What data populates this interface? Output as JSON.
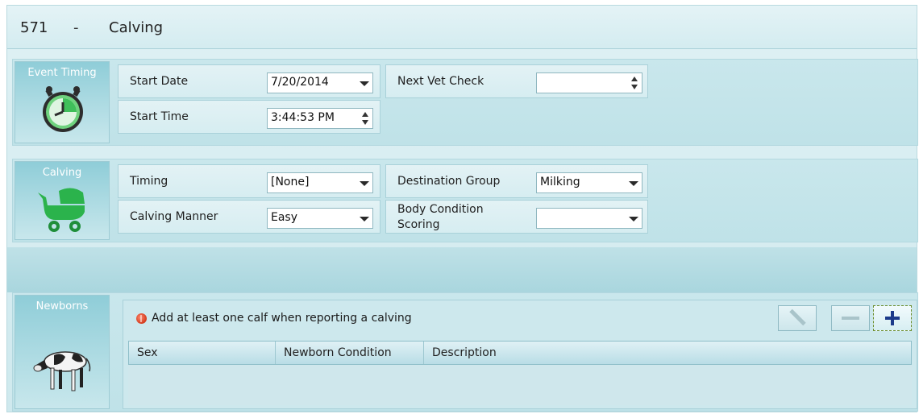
{
  "header": {
    "record_id": "571",
    "separator": "-",
    "title": "Calving"
  },
  "event_timing": {
    "label": "Event Timing",
    "icon": "stopwatch-icon",
    "start_date": {
      "label": "Start Date",
      "value": "7/20/2014"
    },
    "start_time": {
      "label": "Start Time",
      "value": "3:44:53 PM"
    },
    "next_vet_check": {
      "label": "Next Vet Check",
      "value": ""
    }
  },
  "calving": {
    "label": "Calving",
    "icon": "baby-carriage-icon",
    "timing": {
      "label": "Timing",
      "value": "[None]"
    },
    "calving_manner": {
      "label": "Calving Manner",
      "value": "Easy"
    },
    "destination_group": {
      "label": "Destination Group",
      "value": "Milking"
    },
    "body_condition": {
      "label_line1": "Body Condition",
      "label_line2": "Scoring",
      "value": ""
    }
  },
  "newborns": {
    "label": "Newborns",
    "icon": "calf-icon",
    "warning": "Add at least one calf when reporting a calving",
    "columns": [
      "Sex",
      "Newborn Condition",
      "Description"
    ],
    "rows": []
  },
  "colors": {
    "accent": "#2aa84a",
    "plus": "#1c3a8a",
    "warning": "#d33a1c"
  }
}
